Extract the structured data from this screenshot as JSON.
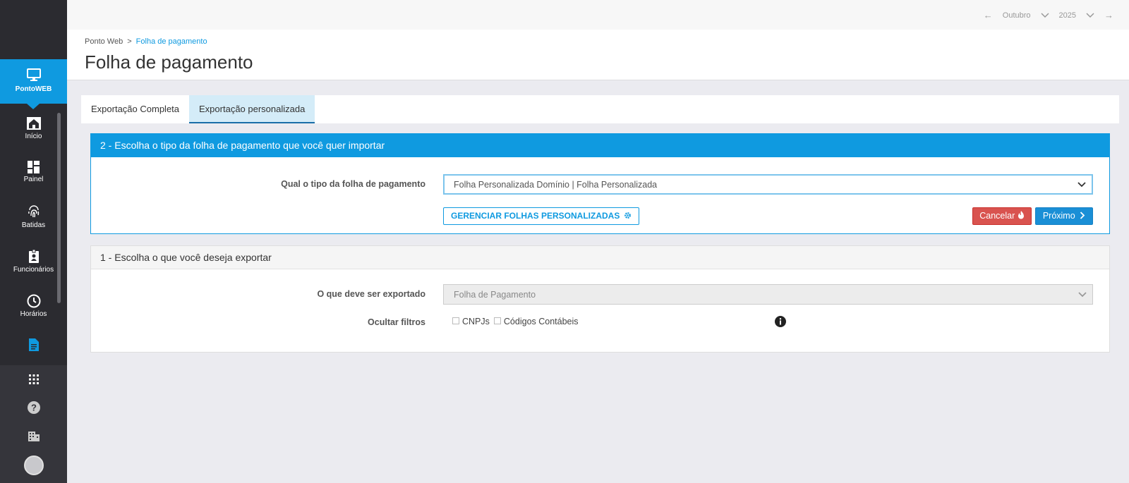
{
  "sidebar": {
    "brand_label": "PontoWEB",
    "items": [
      {
        "label": "Início",
        "icon": "home-icon"
      },
      {
        "label": "Painel",
        "icon": "dashboard-icon"
      },
      {
        "label": "Batidas",
        "icon": "fingerprint-icon"
      },
      {
        "label": "Funcionários",
        "icon": "badge-icon"
      },
      {
        "label": "Horários",
        "icon": "clock-icon"
      },
      {
        "label": "",
        "icon": "document-icon"
      }
    ],
    "bottom_icons": [
      "apps-grid-icon",
      "help-icon",
      "building-icon",
      "user-avatar"
    ]
  },
  "topbar": {
    "month": "Outubro",
    "year": "2025"
  },
  "breadcrumb": {
    "root": "Ponto Web",
    "separator": ">",
    "current": "Folha de pagamento"
  },
  "page_title": "Folha de pagamento",
  "tabs": [
    {
      "label": "Exportação Completa",
      "active": false
    },
    {
      "label": "Exportação personalizada",
      "active": true
    }
  ],
  "panel_type": {
    "header": "2 - Escolha o tipo da folha de pagamento que você quer importar",
    "field_label": "Qual o tipo da folha de pagamento",
    "field_value": "Folha Personalizada Domínio | Folha Personalizada",
    "manage_button": "GERENCIAR FOLHAS PERSONALIZADAS",
    "cancel_button": "Cancelar",
    "next_button": "Próximo"
  },
  "panel_export": {
    "header": "1 - Escolha o que você deseja exportar",
    "field_label": "O que deve ser exportado",
    "field_value": "Folha de Pagamento",
    "filters_label": "Ocultar filtros",
    "filters": [
      {
        "label": "CNPJs",
        "checked": false
      },
      {
        "label": "Códigos Contábeis",
        "checked": false
      }
    ]
  },
  "colors": {
    "primary": "#0f9ae0",
    "sidebar": "#2b2b30",
    "danger": "#d9534f"
  }
}
